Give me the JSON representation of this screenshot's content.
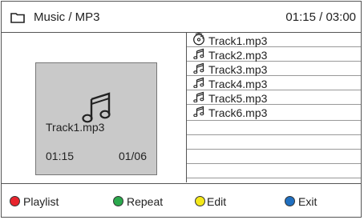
{
  "header": {
    "path": "Music / MP3",
    "time": "01:15 / 03:00",
    "folder_icon": "folder-icon"
  },
  "now_playing": {
    "title": "Track1.mp3",
    "elapsed": "01:15",
    "index": "01/06",
    "icon": "music-note-icon"
  },
  "playlist": {
    "items": [
      {
        "label": "Track1.mp3",
        "icon": "disc-playing-icon"
      },
      {
        "label": "Track2.mp3",
        "icon": "music-note-icon"
      },
      {
        "label": "Track3.mp3",
        "icon": "music-note-icon"
      },
      {
        "label": "Track4.mp3",
        "icon": "music-note-icon"
      },
      {
        "label": "Track5.mp3",
        "icon": "music-note-icon"
      },
      {
        "label": "Track6.mp3",
        "icon": "music-note-icon"
      }
    ]
  },
  "footer": {
    "keys": [
      {
        "label": "Playlist",
        "color": "#e8242d"
      },
      {
        "label": "Repeat",
        "color": "#2ba94d"
      },
      {
        "label": "Edit",
        "color": "#f4e81a"
      },
      {
        "label": "Exit",
        "color": "#1f6fc0"
      }
    ]
  }
}
